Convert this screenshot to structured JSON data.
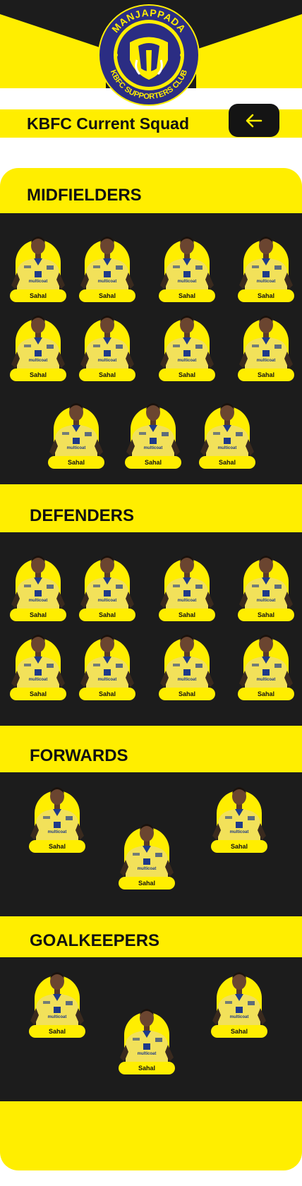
{
  "header": {
    "logo": {
      "top_text": "MANJAPPADA",
      "bottom_text": "KBFC SUPPORTERS CLUB",
      "icon": "elephant-icon"
    },
    "title": "KBFC Current Squad",
    "back_icon": "arrow-left-icon"
  },
  "colors": {
    "accent": "#FFEE00",
    "dark": "#1C1C1C",
    "logo_blue": "#2B2D83"
  },
  "jersey_text": "multicoat",
  "sections": [
    {
      "title": "MIDFIELDERS",
      "players": [
        "Sahal",
        "Sahal",
        "Sahal",
        "Sahal",
        "Sahal",
        "Sahal",
        "Sahal",
        "Sahal",
        "Sahal",
        "Sahal",
        "Sahal"
      ]
    },
    {
      "title": "DEFENDERS",
      "players": [
        "Sahal",
        "Sahal",
        "Sahal",
        "Sahal",
        "Sahal",
        "Sahal",
        "Sahal",
        "Sahal"
      ]
    },
    {
      "title": "FORWARDS",
      "players": [
        "Sahal",
        "Sahal",
        "Sahal"
      ]
    },
    {
      "title": "GOALKEEPERS",
      "players": [
        "Sahal",
        "Sahal",
        "Sahal"
      ]
    }
  ]
}
